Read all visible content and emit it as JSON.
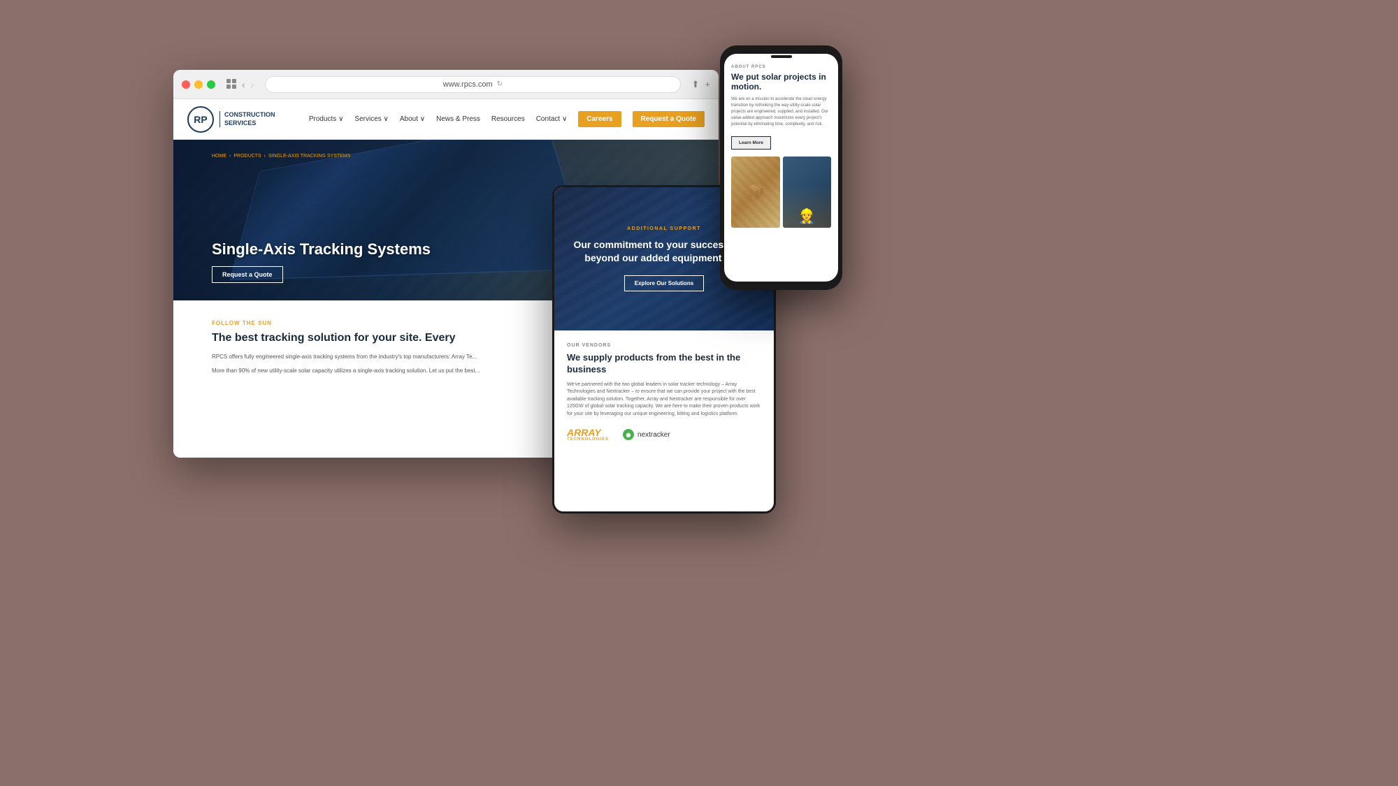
{
  "background": {
    "color": "#8B6F6A"
  },
  "browser": {
    "address": "www.rpcs.com",
    "traffic_lights": [
      "red",
      "yellow",
      "green"
    ]
  },
  "website": {
    "logo": {
      "letters": "RP",
      "company_line1": "CONSTRUCTION",
      "company_line2": "SERVICES"
    },
    "nav": {
      "links": [
        {
          "label": "Products ∨",
          "has_dropdown": true
        },
        {
          "label": "Services ∨",
          "has_dropdown": true
        },
        {
          "label": "About ∨",
          "has_dropdown": true
        },
        {
          "label": "News & Press",
          "has_dropdown": false
        },
        {
          "label": "Resources",
          "has_dropdown": false
        },
        {
          "label": "Contact ∨",
          "has_dropdown": true
        }
      ],
      "cta_careers": "Careers",
      "cta_quote": "Request a Quote"
    },
    "hero": {
      "breadcrumb": "HOME > PRODUCTS > SINGLE-AXIS TRACKING SYSTEMS",
      "title": "Single-Axis Tracking Systems",
      "button": "Request a Quote"
    },
    "content": {
      "eyebrow": "FOLLOW THE SUN",
      "title": "The best tracking solution for your site. Every",
      "text1": "RPCS offers fully engineered single-axis tracking systems from the industry's top manufacturers: Array Te...",
      "text2": "More than 90% of new utility-scale solar capacity utilizes a single-axis tracking solution. Let us put the best..."
    }
  },
  "tablet": {
    "hero": {
      "eyebrow": "ADDITIONAL SUPPORT",
      "title": "Our commitment to your success goes beyond our added equipment sa...",
      "button": "Explore Our Solutions"
    },
    "vendors": {
      "eyebrow": "OUR VENDORS",
      "title": "We supply products from the best in the business",
      "text": "We've partnered with the two global leaders in solar tracker technology – Array Technologies and Nextracker – to ensure that we can provide your project with the best available tracking solution. Together, Array and Nextracker are responsible for over 125GW of global solar tracking capacity. We are here to make their proven products work for your site by leveraging our unique engineering, kitting and logistics platform.",
      "array_logo": "ARRAY",
      "array_sub": "TECHNOLOGIES",
      "nextracker_logo": "nextracker"
    }
  },
  "phone": {
    "about_label": "ABOUT RPCS",
    "title": "We put solar projects in motion.",
    "text": "We are on a mission to accelerate the clean energy transition by rethinking the way utility-scale solar projects are engineered, supplied, and installed. Our value-added approach maximizes every project's potential by eliminating time, complexity, and risk.",
    "learn_more_btn": "Learn More"
  }
}
